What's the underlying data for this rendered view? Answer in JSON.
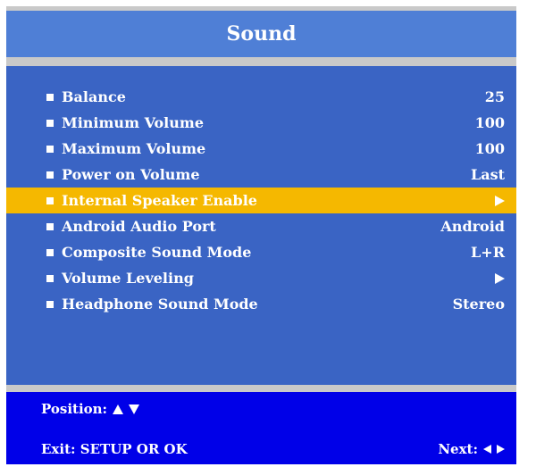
{
  "title": "Sound",
  "menu": {
    "items": [
      {
        "label": "Balance",
        "value": "25"
      },
      {
        "label": "Minimum Volume",
        "value": "100"
      },
      {
        "label": "Maximum Volume",
        "value": "100"
      },
      {
        "label": "Power on Volume",
        "value": "Last"
      },
      {
        "label": "Internal Speaker Enable",
        "value_icon": "submenu-arrow-icon",
        "selected": true
      },
      {
        "label": "Android Audio Port",
        "value": "Android"
      },
      {
        "label": "Composite Sound Mode",
        "value": "L+R"
      },
      {
        "label": "Volume Leveling",
        "value_icon": "submenu-arrow-icon"
      },
      {
        "label": "Headphone Sound Mode",
        "value": "Stereo"
      }
    ]
  },
  "footer": {
    "position_label": "Position:",
    "exit_label": "Exit:  SETUP OR OK",
    "next_label": "Next:"
  },
  "colors": {
    "frame": "#c9c9c9",
    "title_bar": "#4f7fd6",
    "menu_bg": "#3a64c4",
    "highlight": "#f5b800",
    "footer_bg": "#0000e8",
    "text": "#ffffff"
  }
}
